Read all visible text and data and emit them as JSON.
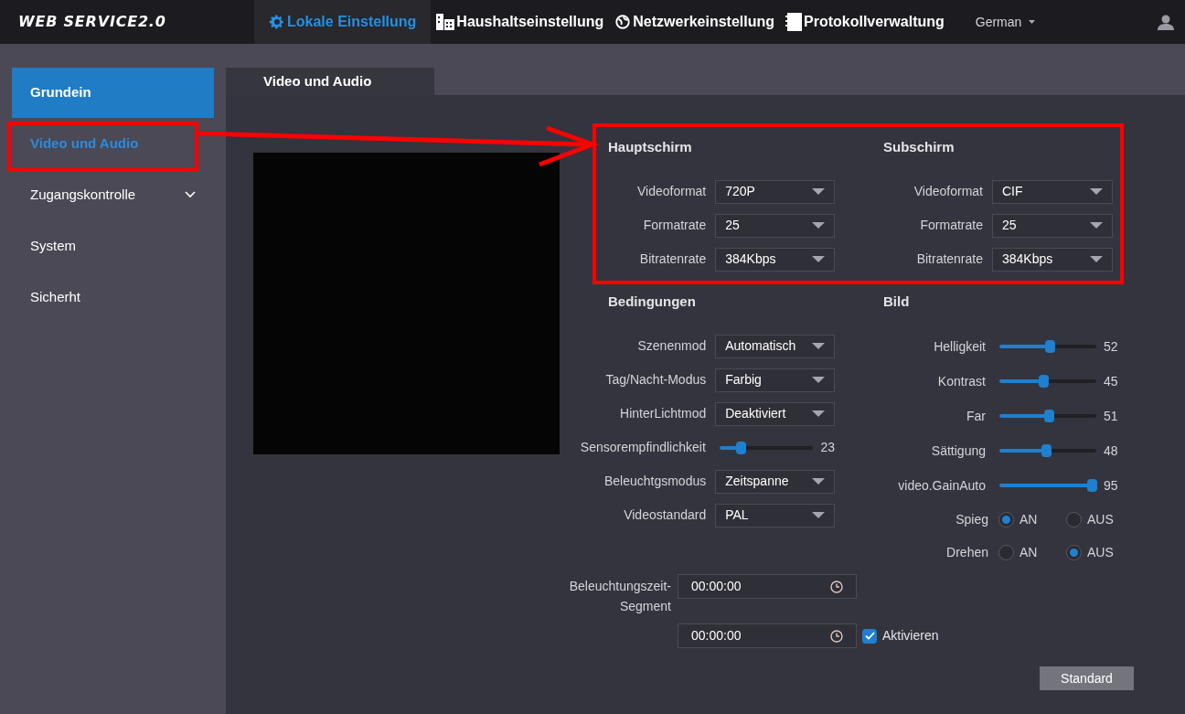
{
  "header": {
    "logo": "WEB SERVICE2.0",
    "language": "German",
    "nav": [
      {
        "label": "Lokale Einstellung",
        "selected": true
      },
      {
        "label": "Haushaltseinstellung",
        "selected": false
      },
      {
        "label": "Netzwerkeinstellung",
        "selected": false
      },
      {
        "label": "Protokollverwaltung",
        "selected": false
      }
    ]
  },
  "sidebar": {
    "items": [
      {
        "label": "Grundein",
        "kind": "header"
      },
      {
        "label": "Video und Audio",
        "kind": "item",
        "selected": true
      },
      {
        "label": "Zugangskontrolle",
        "kind": "submenu",
        "selected": false,
        "expanded": false
      },
      {
        "label": "System",
        "kind": "item",
        "selected": false
      },
      {
        "label": "Sicherht",
        "kind": "item",
        "selected": false
      }
    ]
  },
  "tabs": [
    {
      "label": "Video und Audio",
      "selected": true
    }
  ],
  "main_stream": {
    "title": "Hauptschirm",
    "fields": [
      {
        "kind": "select",
        "label": "Videoformat",
        "value": "720P"
      },
      {
        "kind": "select",
        "label": "Formatrate",
        "value": "25"
      },
      {
        "kind": "select",
        "label": "Bitratenrate",
        "value": "384Kbps"
      }
    ]
  },
  "sub_stream": {
    "title": "Subschirm",
    "fields": [
      {
        "kind": "select",
        "label": "Videoformat",
        "value": "CIF"
      },
      {
        "kind": "select",
        "label": "Formatrate",
        "value": "25"
      },
      {
        "kind": "select",
        "label": "Bitratenrate",
        "value": "384Kbps"
      }
    ]
  },
  "conditions": {
    "title": "Bedingungen",
    "fields": [
      {
        "kind": "select",
        "label": "Szenenmod",
        "value": "Automatisch"
      },
      {
        "kind": "select",
        "label": "Tag/Nacht-Modus",
        "value": "Farbig"
      },
      {
        "kind": "select",
        "label": "HinterLichtmod",
        "value": "Deaktiviert"
      },
      {
        "kind": "slider",
        "label": "Sensorempfindlichkeit",
        "level": 0.23,
        "reading": "23"
      },
      {
        "kind": "select",
        "label": "Beleuchtgsmodus",
        "value": "Zeitspanne"
      },
      {
        "kind": "select",
        "label": "Videostandard",
        "value": "PAL"
      }
    ]
  },
  "image": {
    "title": "Bild",
    "fields": [
      {
        "kind": "slider",
        "label": "Helligkeit",
        "level": 0.52,
        "reading": "52"
      },
      {
        "kind": "slider",
        "label": "Kontrast",
        "level": 0.45,
        "reading": "45"
      },
      {
        "kind": "slider",
        "label": "Far",
        "level": 0.51,
        "reading": "51"
      },
      {
        "kind": "slider",
        "label": "Sättigung",
        "level": 0.48,
        "reading": "48"
      },
      {
        "kind": "slider",
        "label": "video.GainAuto",
        "level": 0.95,
        "reading": "95"
      },
      {
        "kind": "radio",
        "label": "Spieg",
        "options": [
          {
            "label": "AN",
            "selected": true
          },
          {
            "label": "AUS",
            "selected": false
          }
        ]
      },
      {
        "kind": "radio",
        "label": "Drehen",
        "options": [
          {
            "label": "AN",
            "selected": false
          },
          {
            "label": "AUS",
            "selected": true
          }
        ]
      }
    ]
  },
  "schedule": {
    "label": "Beleuchtungszeit-Segment",
    "times": [
      "00:00:00",
      "00:00:00"
    ],
    "enable": {
      "label": "Aktivieren",
      "checked": true
    }
  },
  "buttons": [
    {
      "label": "Standard"
    }
  ]
}
